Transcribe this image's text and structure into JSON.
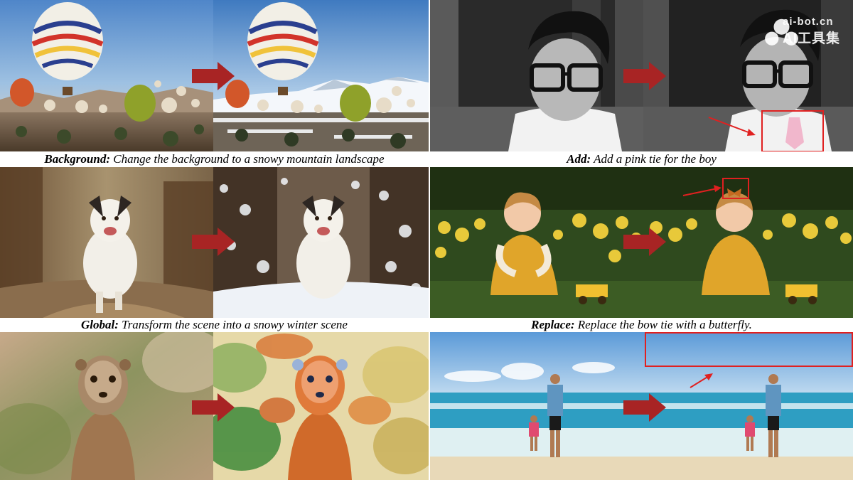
{
  "captions": {
    "background": {
      "label": "Background:",
      "text": " Change the background to a snowy mountain landscape"
    },
    "add": {
      "label": "Add:",
      "text": " Add a pink tie for the boy"
    },
    "global": {
      "label": "Global:",
      "text": " Transform the scene into a snowy winter scene"
    },
    "replace": {
      "label": "Replace:",
      "text": " Replace the bow tie with a butterfly."
    }
  },
  "watermark": {
    "line1": "ai-bot.cn",
    "line2": "AI工具集"
  },
  "colors": {
    "arrow": "#a82424",
    "highlight": "#e02020"
  }
}
